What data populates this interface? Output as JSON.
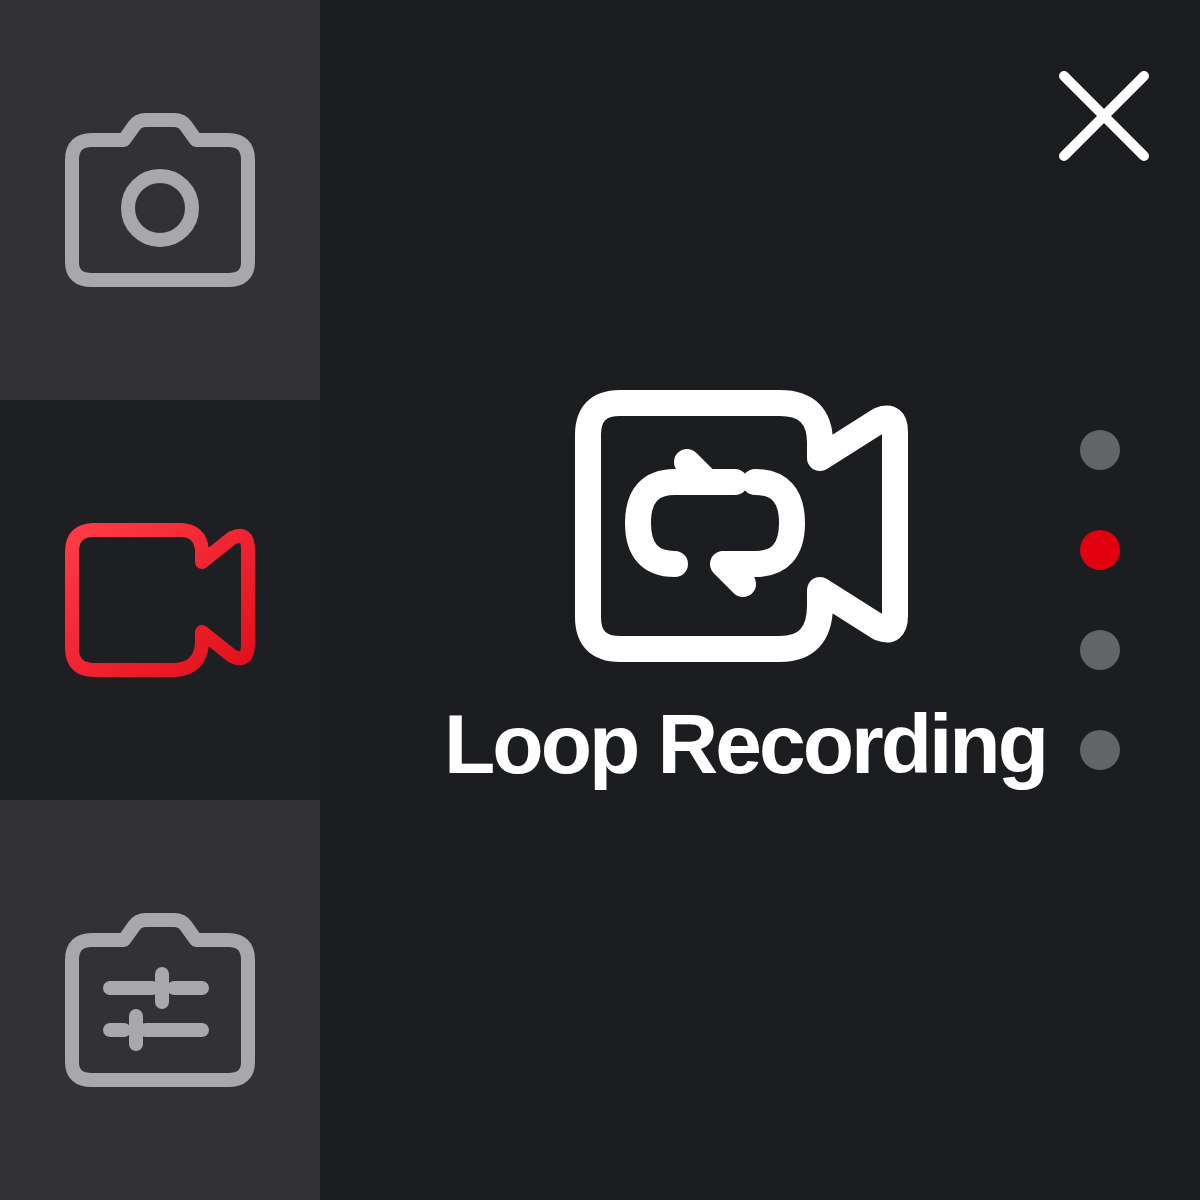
{
  "sidebar": {
    "items": [
      {
        "kind": "photo",
        "selected": false
      },
      {
        "kind": "video",
        "selected": true
      },
      {
        "kind": "settings",
        "selected": false
      }
    ]
  },
  "mode": {
    "kind": "loop",
    "title": "Loop Recording"
  },
  "pager": {
    "dots": [
      {
        "selected": false
      },
      {
        "selected": true
      },
      {
        "selected": false
      },
      {
        "selected": false
      }
    ]
  }
}
